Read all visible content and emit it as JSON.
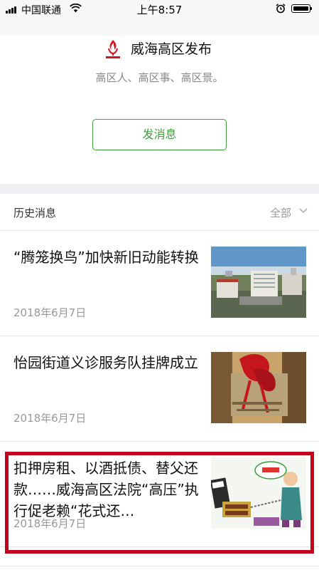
{
  "status_bar": {
    "carrier": "中国联通",
    "time": "上午8:57",
    "icons": [
      "signal-icon",
      "wifi-icon",
      "alarm-icon",
      "battery-icon"
    ]
  },
  "account": {
    "name": "威海高区发布",
    "description": "高区人、高区事、高区景。",
    "send_button": "发消息",
    "logo_icon": "torch-logo-icon"
  },
  "history": {
    "title": "历史消息",
    "filter_label": "全部"
  },
  "articles": [
    {
      "title": "“腾笼换鸟”加快新旧动能转换",
      "date": "2018年6月7日",
      "thumb_icon": "city-buildings-thumbnail"
    },
    {
      "title": "怡园街道义诊服务队挂牌成立",
      "date": "2018年6月7日",
      "thumb_icon": "red-ribbon-plaque-thumbnail"
    },
    {
      "title": "扣押房租、以酒抵债、替父还款……威海高区法院“高压”执行促老赖“花式还…",
      "date": "2018年6月7日",
      "thumb_icon": "court-cartoon-thumbnail"
    }
  ],
  "highlight_color": "#c4001c",
  "accent_color": "#3ea03b"
}
